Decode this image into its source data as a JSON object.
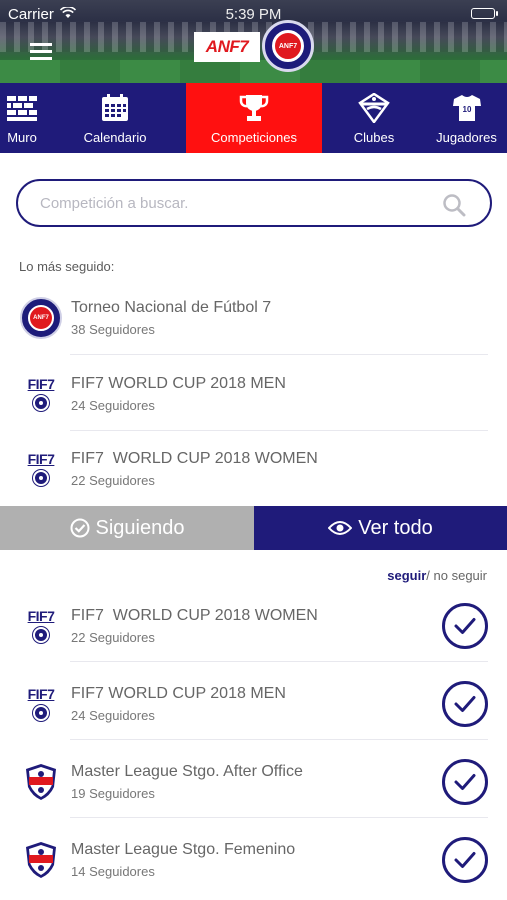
{
  "status_bar": {
    "carrier": "Carrier",
    "time": "5:39 PM"
  },
  "header": {
    "logo_text": "ANF7",
    "crest_text": "ANF7"
  },
  "tabs": [
    {
      "label": "Muro",
      "icon": "wall-icon",
      "active": false
    },
    {
      "label": "Calendario",
      "icon": "calendar-icon",
      "active": false
    },
    {
      "label": "Competiciones",
      "icon": "trophy-icon",
      "active": true
    },
    {
      "label": "Clubes",
      "icon": "club-shield-icon",
      "active": false
    },
    {
      "label": "Jugadores",
      "icon": "jersey-icon",
      "active": false
    }
  ],
  "search": {
    "placeholder": "Competición a buscar."
  },
  "most_followed": {
    "label": "Lo más seguido:",
    "items": [
      {
        "title": "Torneo Nacional de Fútbol 7",
        "followers": "38 Seguidores",
        "logo": "anf7-crest-logo"
      },
      {
        "title": "FIF7 WORLD CUP 2018 MEN",
        "followers": "24 Seguidores",
        "logo": "fif7-logo"
      },
      {
        "title": "FIF7  WORLD CUP 2018 WOMEN",
        "followers": "22 Seguidores",
        "logo": "fif7-logo"
      }
    ]
  },
  "toggle": {
    "following_label": "Siguiendo",
    "view_all_label": "Ver todo",
    "active": "view_all"
  },
  "follow_links": {
    "follow": "seguir",
    "separator": "/",
    "unfollow": " no seguir"
  },
  "all_items": [
    {
      "title": "FIF7  WORLD CUP 2018 WOMEN",
      "followers": "22 Seguidores",
      "logo": "fif7-logo",
      "following": true
    },
    {
      "title": "FIF7 WORLD CUP 2018 MEN",
      "followers": "24 Seguidores",
      "logo": "fif7-logo",
      "following": true
    },
    {
      "title": "Master League Stgo. After Office",
      "followers": "19 Seguidores",
      "logo": "master-league-logo",
      "following": true
    },
    {
      "title": "Master League Stgo. Femenino",
      "followers": "14 Seguidores",
      "logo": "master-league-logo",
      "following": true
    }
  ],
  "colors": {
    "brand_navy": "#1f1b7a",
    "active_tab_red": "#ff1010",
    "inactive_toggle_gray": "#b0b0b0"
  }
}
